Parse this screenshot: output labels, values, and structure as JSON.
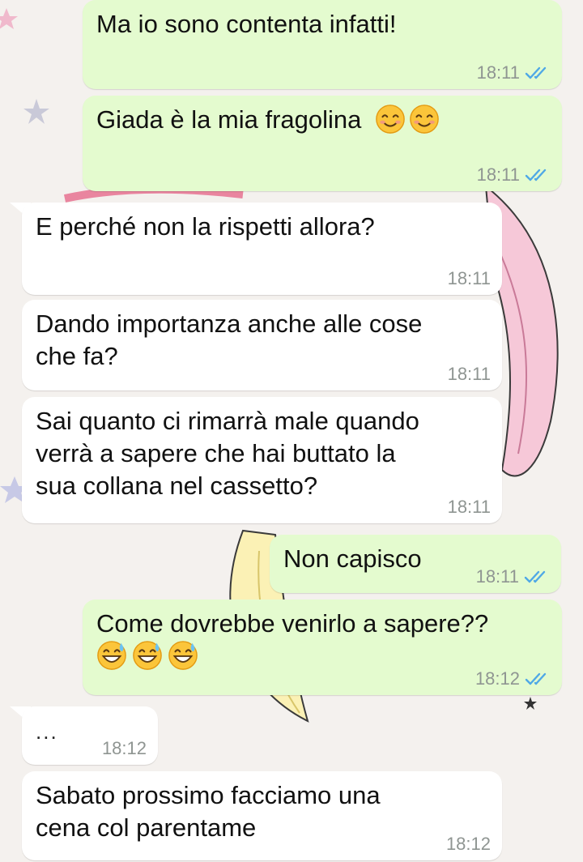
{
  "colors": {
    "outgoing_bubble": "#e4fbcf",
    "incoming_bubble": "#ffffff",
    "read_ticks": "#4fa8e6",
    "timestamp": "#8f9592"
  },
  "messages": [
    {
      "direction": "outgoing",
      "text": "Ma io sono contenta infatti!",
      "time": "18:11",
      "status": "read"
    },
    {
      "direction": "outgoing",
      "text": "Giada è la mia fragolina",
      "emoji": [
        "smiling-face-icon",
        "smiling-face-icon"
      ],
      "time": "18:11",
      "status": "read"
    },
    {
      "direction": "incoming",
      "text": "E perché non la rispetti allora?",
      "time": "18:11"
    },
    {
      "direction": "incoming",
      "text": "Dando importanza anche alle cose\nche fa?",
      "time": "18:11"
    },
    {
      "direction": "incoming",
      "text": "Sai quanto ci rimarrà male quando\nverrà a sapere che hai buttato la\nsua collana nel cassetto?",
      "time": "18:11"
    },
    {
      "direction": "outgoing",
      "text": "Non capisco",
      "time": "18:11",
      "status": "read"
    },
    {
      "direction": "outgoing",
      "text": "Come dovrebbe venirlo a sapere??",
      "emoji": [
        "grinning-sweat-icon",
        "grinning-sweat-icon",
        "grinning-sweat-icon"
      ],
      "time": "18:12",
      "status": "read"
    },
    {
      "direction": "incoming",
      "text": "...",
      "time": "18:12"
    },
    {
      "direction": "incoming",
      "text": "Sabato prossimo facciamo una\ncena col parentame",
      "time": "18:12"
    }
  ]
}
